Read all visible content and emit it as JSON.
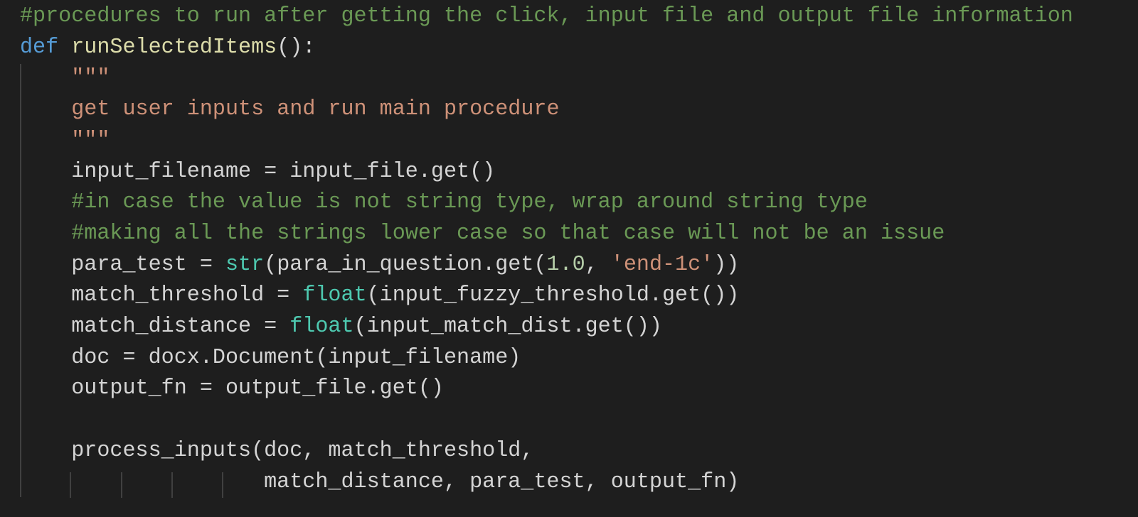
{
  "editor": {
    "language": "python",
    "theme_colors": {
      "background": "#1e1e1e",
      "comment": "#6a9955",
      "keyword": "#569cd6",
      "function": "#dcdcaa",
      "string": "#ce9178",
      "builtin": "#4ec9b0",
      "number": "#b5cea8",
      "text": "#d4d4d4"
    },
    "lines": [
      [
        {
          "t": "cmt",
          "v": "#procedures to run after getting the click, input file and output file information"
        }
      ],
      [
        {
          "t": "kw",
          "v": "def"
        },
        {
          "t": "txt",
          "v": " "
        },
        {
          "t": "fn",
          "v": "runSelectedItems"
        },
        {
          "t": "txt",
          "v": "():"
        }
      ],
      [
        {
          "t": "txt",
          "v": "    "
        },
        {
          "t": "str",
          "v": "\"\"\""
        }
      ],
      [
        {
          "t": "txt",
          "v": "    "
        },
        {
          "t": "str",
          "v": "get user inputs and run main procedure"
        }
      ],
      [
        {
          "t": "txt",
          "v": "    "
        },
        {
          "t": "str",
          "v": "\"\"\""
        }
      ],
      [
        {
          "t": "txt",
          "v": "    input_filename = input_file.get()"
        }
      ],
      [
        {
          "t": "txt",
          "v": "    "
        },
        {
          "t": "cmt",
          "v": "#in case the value is not string type, wrap around string type"
        }
      ],
      [
        {
          "t": "txt",
          "v": "    "
        },
        {
          "t": "cmt",
          "v": "#making all the strings lower case so that case will not be an issue"
        }
      ],
      [
        {
          "t": "txt",
          "v": "    para_test = "
        },
        {
          "t": "bi",
          "v": "str"
        },
        {
          "t": "txt",
          "v": "(para_in_question.get("
        },
        {
          "t": "num",
          "v": "1.0"
        },
        {
          "t": "txt",
          "v": ", "
        },
        {
          "t": "str",
          "v": "'end-1c'"
        },
        {
          "t": "txt",
          "v": "))"
        }
      ],
      [
        {
          "t": "txt",
          "v": "    match_threshold = "
        },
        {
          "t": "bi",
          "v": "float"
        },
        {
          "t": "txt",
          "v": "(input_fuzzy_threshold.get())"
        }
      ],
      [
        {
          "t": "txt",
          "v": "    match_distance = "
        },
        {
          "t": "bi",
          "v": "float"
        },
        {
          "t": "txt",
          "v": "(input_match_dist.get())"
        }
      ],
      [
        {
          "t": "txt",
          "v": "    doc = docx.Document(input_filename)"
        }
      ],
      [
        {
          "t": "txt",
          "v": "    output_fn = output_file.get()"
        }
      ],
      [
        {
          "t": "txt",
          "v": ""
        }
      ],
      [
        {
          "t": "txt",
          "v": "    process_inputs(doc, match_threshold,"
        }
      ],
      [
        {
          "t": "txt",
          "v": "                   match_distance, para_test, output_fn)"
        }
      ]
    ]
  }
}
